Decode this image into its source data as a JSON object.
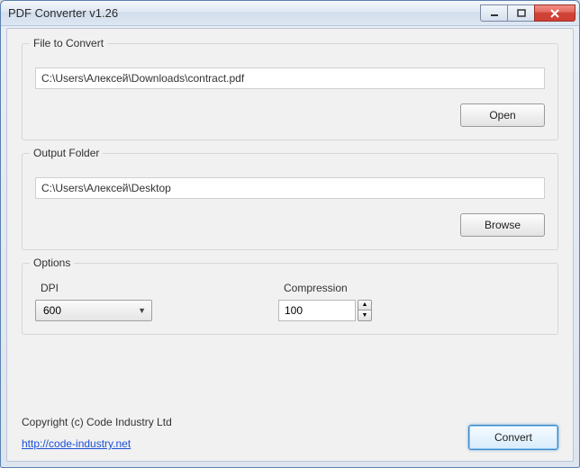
{
  "window": {
    "title": "PDF Converter v1.26"
  },
  "file_group": {
    "label": "File to Convert",
    "path": "C:\\Users\\Алексей\\Downloads\\contract.pdf",
    "open_label": "Open"
  },
  "output_group": {
    "label": "Output Folder",
    "path": "C:\\Users\\Алексей\\Desktop",
    "browse_label": "Browse"
  },
  "options_group": {
    "label": "Options",
    "dpi_label": "DPI",
    "dpi_value": "600",
    "compression_label": "Compression",
    "compression_value": "100"
  },
  "footer": {
    "copyright": "Copyright (c) Code Industry Ltd",
    "link": "http://code-industry.net",
    "convert_label": "Convert"
  }
}
